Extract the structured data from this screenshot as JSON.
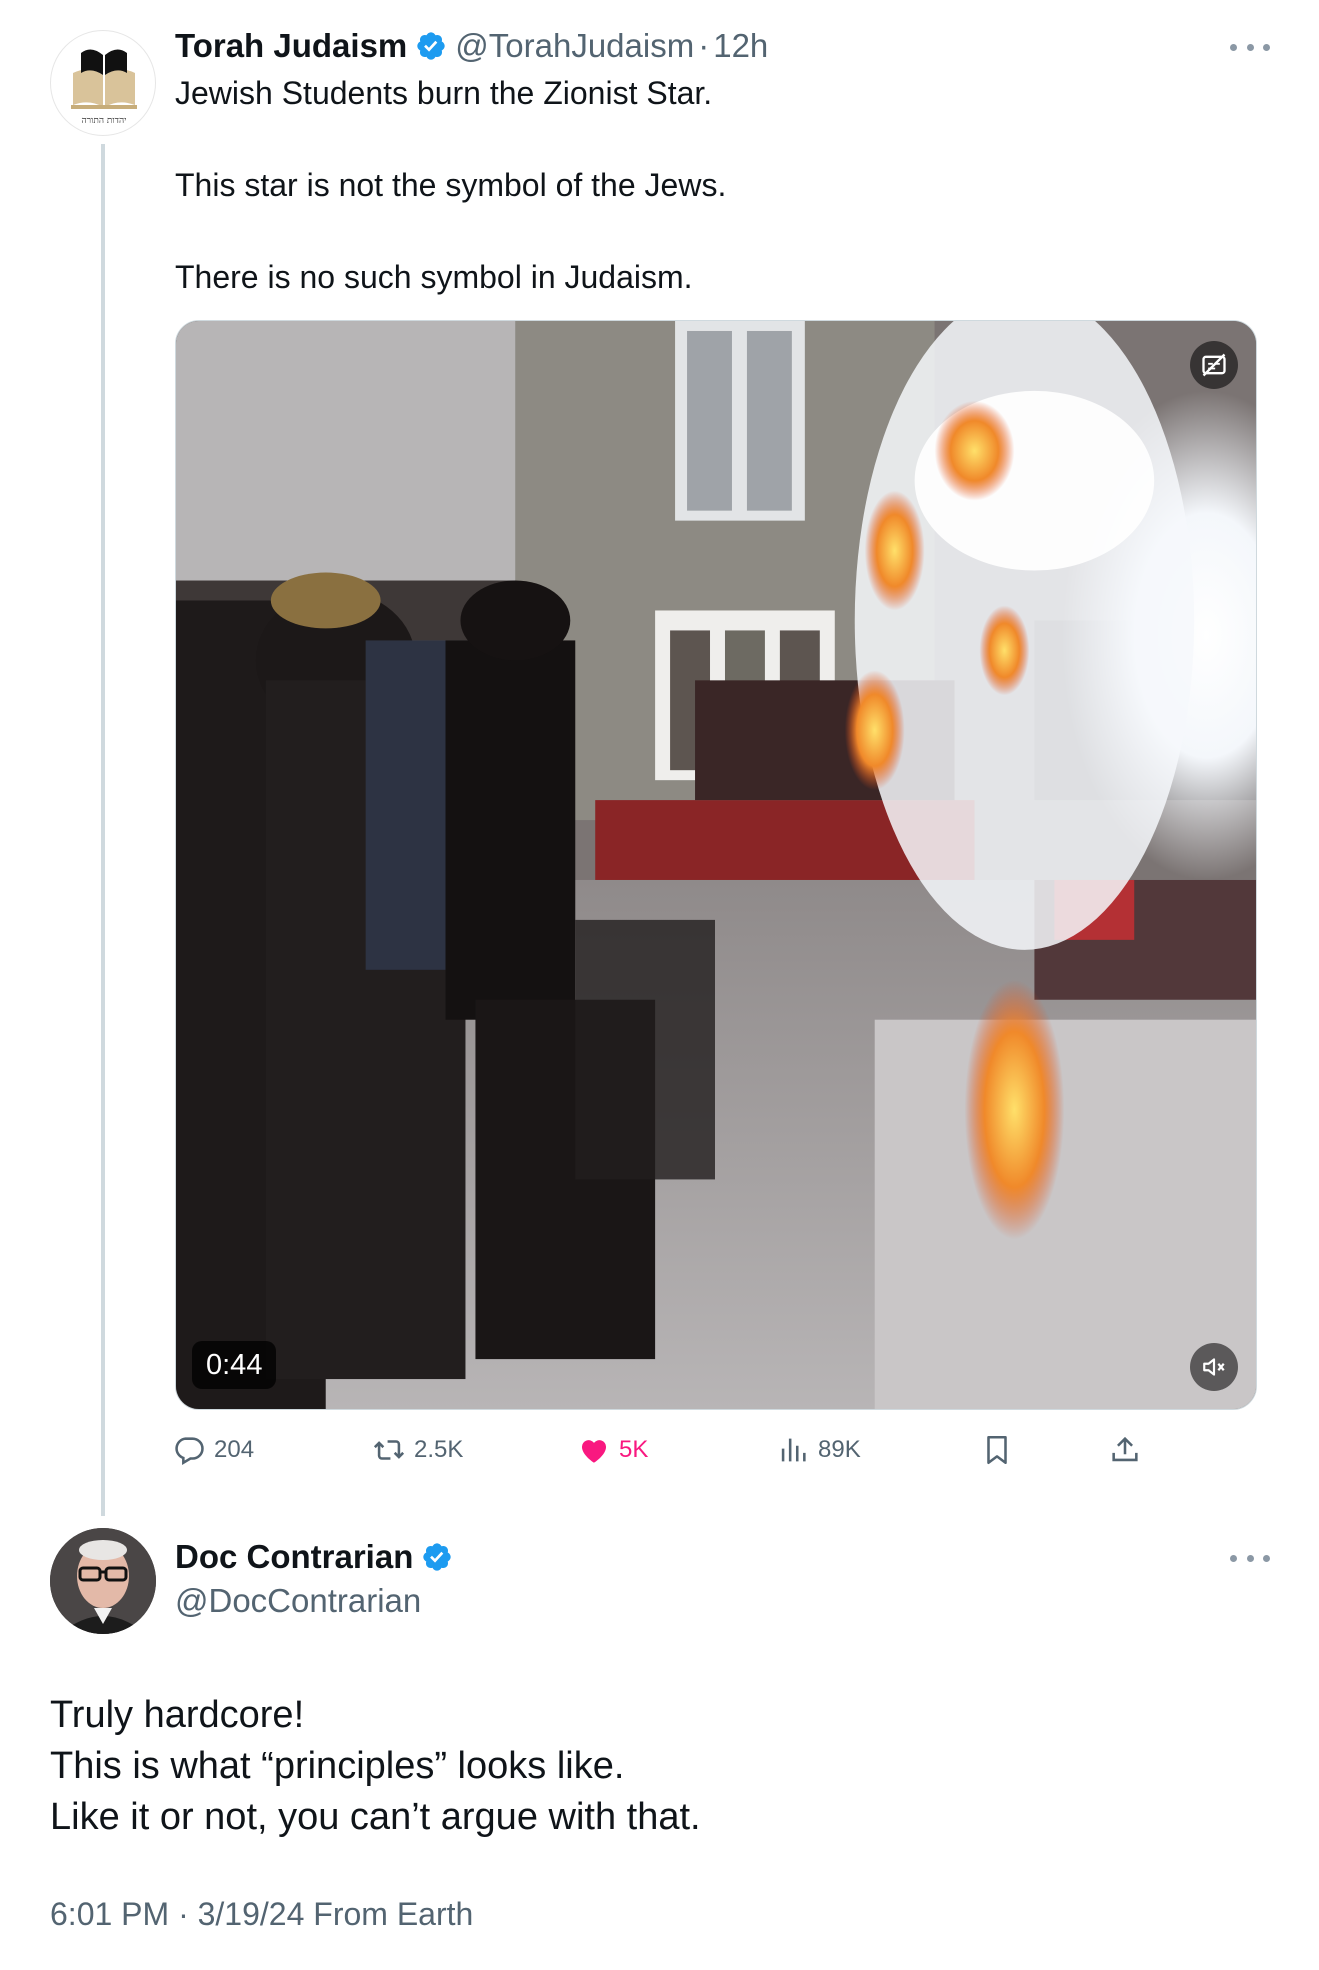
{
  "tweet": {
    "author_name": "Torah Judaism",
    "handle": "@TorahJudaism",
    "separator": "·",
    "time": "12h",
    "avatar_caption": "יהדות התורה",
    "text": [
      "Jewish Students burn the Zionist Star.",
      "This star is not the symbol of the Jews.",
      "There is no such symbol in Judaism."
    ],
    "video_duration": "0:44",
    "stats": {
      "replies": "204",
      "reposts": "2.5K",
      "likes": "5K",
      "views": "89K"
    }
  },
  "reply": {
    "author_name": "Doc Contrarian",
    "handle": "@DocContrarian",
    "text": [
      "Truly hardcore!",
      "This is what “principles” looks like.",
      "Like it or not, you can’t argue with that."
    ],
    "meta": "6:01 PM · 3/19/24 From Earth"
  },
  "colors": {
    "verified": "#1d9bf0",
    "like_active": "#f91880",
    "secondary_text": "#536471"
  }
}
